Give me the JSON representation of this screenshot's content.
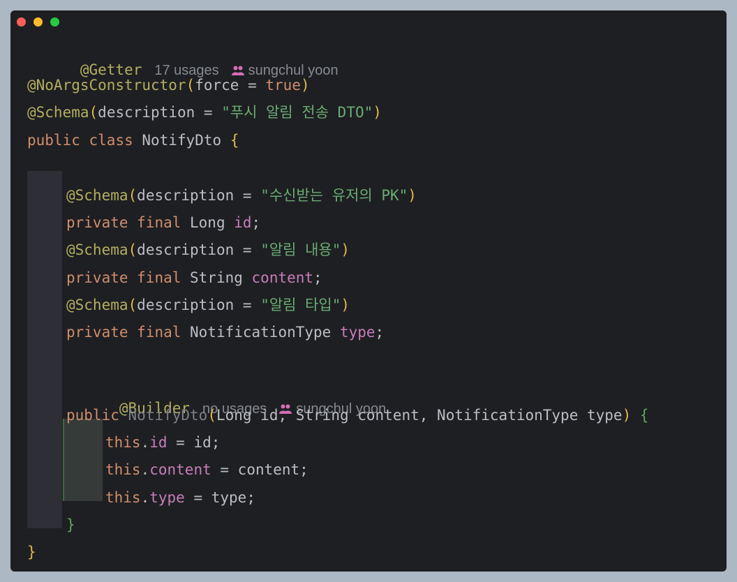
{
  "window": {
    "buttons": [
      "close",
      "minimize",
      "maximize"
    ]
  },
  "lines": {
    "l1": {
      "annotation": "@Getter",
      "usages": "17 usages",
      "author": "sungchul yoon"
    },
    "l2": {
      "annotation": "@NoArgsConstructor",
      "open": "(",
      "arg": "force = ",
      "value": "true",
      "close": ")"
    },
    "l3": {
      "annotation": "@Schema",
      "open": "(",
      "arg": "description = ",
      "value": "\"푸시 알림 전송 DTO\"",
      "close": ")"
    },
    "l4": {
      "kw1": "public ",
      "kw2": "class ",
      "name": "NotifyDto ",
      "brace": "{"
    },
    "l6": {
      "annotation": "@Schema",
      "open": "(",
      "arg": "description = ",
      "value": "\"수신받는 유저의 PK\"",
      "close": ")"
    },
    "l7": {
      "kw1": "private ",
      "kw2": "final ",
      "type": "Long ",
      "field": "id",
      "end": ";"
    },
    "l8": {
      "annotation": "@Schema",
      "open": "(",
      "arg": "description = ",
      "value": "\"알림 내용\"",
      "close": ")"
    },
    "l9": {
      "kw1": "private ",
      "kw2": "final ",
      "type": "String ",
      "field": "content",
      "end": ";"
    },
    "l10": {
      "annotation": "@Schema",
      "open": "(",
      "arg": "description = ",
      "value": "\"알림 타입\"",
      "close": ")"
    },
    "l11": {
      "kw1": "private ",
      "kw2": "final ",
      "type": "NotificationType ",
      "field": "type",
      "end": ";"
    },
    "l13": {
      "annotation": "@Builder",
      "usages": "no usages",
      "author": "sungchul yoon"
    },
    "l14": {
      "kw1": "public ",
      "name": "NotifyDto",
      "open": "(",
      "params": "Long id, String content, NotificationType type",
      "close": ") ",
      "brace": "{"
    },
    "l15": {
      "this": "this",
      "dot": ".",
      "field": "id",
      "rest": " = id;"
    },
    "l16": {
      "this": "this",
      "dot": ".",
      "field": "content",
      "rest": " = content;"
    },
    "l17": {
      "this": "this",
      "dot": ".",
      "field": "type",
      "rest": " = type;"
    },
    "l18": {
      "brace": "}"
    },
    "l19": {
      "brace": "}"
    }
  },
  "colors": {
    "background": "#1e1f22",
    "annotation": "#b3ae60",
    "keyword": "#cf8e6d",
    "string": "#6aab73",
    "field": "#c77dbb",
    "brace": "#e0b94f"
  }
}
